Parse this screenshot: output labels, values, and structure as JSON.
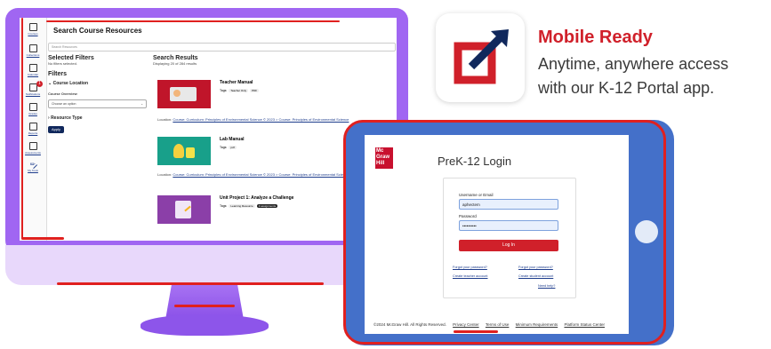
{
  "monitor_app": {
    "page_title": "Search Course Resources",
    "search_placeholder": "Search Resources",
    "nav": [
      {
        "label": "Courses"
      },
      {
        "label": "Collections"
      },
      {
        "label": "Calendar"
      },
      {
        "label": "Notifications",
        "badge": "1"
      },
      {
        "label": "Grades"
      },
      {
        "label": "Reports"
      },
      {
        "label": "Assessments"
      },
      {
        "label": "My Tools"
      }
    ],
    "selected_filters_heading": "Selected Filters",
    "no_filters_text": "No filters selected.",
    "filters_heading": "Filters",
    "course_location_label": "Course Location",
    "course_overview_label": "Course Overview",
    "select_placeholder": "Choose an option",
    "resource_type_label": "Resource Type",
    "apply_label": "Apply",
    "results_heading": "Search Results",
    "results_count": "Displaying 20 of 284 results",
    "results": [
      {
        "title": "Teacher Manual",
        "tags_label": "Tags:",
        "tags": [
          "Teacher Only",
          "PDF"
        ],
        "location_prefix": "Location:",
        "location": "Course: Curriculum: Principles of Environmental Science © 2023 > Course: Principles of Environmental Science"
      },
      {
        "title": "Lab Manual",
        "tags_label": "Tags:",
        "tags": [
          "pdf"
        ],
        "location_prefix": "Location:",
        "location": "Course: Curriculum: Principles of Environmental Science © 2023 > Course: Principles of Environmental Science"
      },
      {
        "title": "Unit Project 1: Analyze a Challenge",
        "tags_label": "Tags:",
        "tags": [
          "Learning Resource",
          "3 assignments"
        ]
      }
    ]
  },
  "promo": {
    "title": "Mobile Ready",
    "subtitle_line1": "Anytime, anywhere access",
    "subtitle_line2": "with our K-12 Portal app."
  },
  "tablet_app": {
    "logo_text": "Mc Graw Hill",
    "login_title": "PreK-12 Login",
    "username_label": "Username or Email",
    "username_value": "aphectem",
    "password_label": "Password",
    "password_value": "••••••••••",
    "login_button": "Log In",
    "forgot_password": "Forgot your password?",
    "forgot_password_alt": "Forgot your password?",
    "create_teacher": "Create teacher account",
    "create_student": "Create student account",
    "need_help": "Need help?",
    "footer": {
      "copyright": "©2024 McGraw Hill. All Rights Reserved.",
      "privacy": "Privacy Center",
      "terms": "Terms of Use",
      "requirements": "Minimum Requirements",
      "status": "Platform Status Center"
    }
  },
  "colors": {
    "accent_red": "#d0202a",
    "monitor_purple": "#a066f2",
    "tablet_blue": "#4470c9",
    "navy": "#10285c"
  }
}
